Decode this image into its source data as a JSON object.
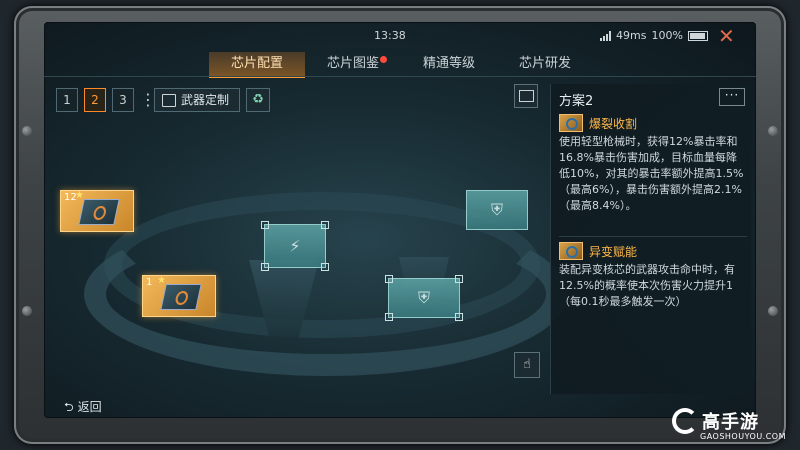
{
  "status": {
    "time": "13:38",
    "network": "49ms",
    "battery": "100%"
  },
  "tabs": [
    {
      "label": "芯片配置",
      "active": true
    },
    {
      "label": "芯片图鉴",
      "badge": true
    },
    {
      "label": "精通等级"
    },
    {
      "label": "芯片研发"
    }
  ],
  "toolbar": {
    "slots": [
      "1",
      "2",
      "3"
    ],
    "active_slot": "2",
    "custom_label": "武器定制"
  },
  "panel": {
    "title": "方案2",
    "chips": [
      {
        "name": "爆裂收割",
        "desc": "使用轻型枪械时，获得12%暴击率和16.8%暴击伤害加成，目标血量每降低10%，对其的暴击率额外提高1.5%（最高6%），暴击伤害额外提高2.1%（最高8.4%）。"
      },
      {
        "name": "异变赋能",
        "desc": "装配异变核芯的武器攻击命中时，有12.5%的概率使本次伤害火力提升1（每0.1秒最多触发一次）"
      }
    ]
  },
  "board": {
    "chip_cards": [
      {
        "level": "12"
      },
      {
        "level": "1"
      }
    ],
    "empty_slots": [
      "shield",
      "weapon",
      "shield",
      "shield"
    ]
  },
  "footer": {
    "back_label": "返回"
  },
  "watermark": {
    "brand": "高手游",
    "domain": "GAOSHOUYOU.COM"
  },
  "colors": {
    "accent": "#ff9a2e",
    "highlight": "#ff9a3a",
    "chip_gold": "#f2b95a",
    "slot_teal": "#5ea6a8"
  }
}
